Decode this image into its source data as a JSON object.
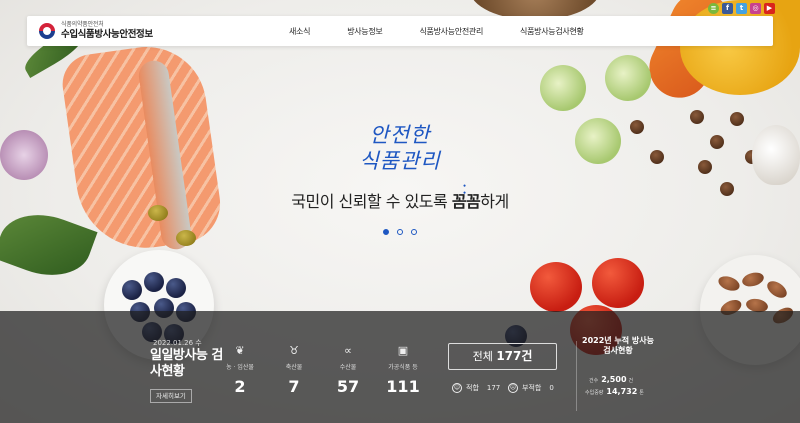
{
  "header": {
    "org_name": "식품의약품안전처",
    "site_name": "수입식품방사능안전정보",
    "nav": [
      "새소식",
      "방사능정보",
      "식품방사능안전관리",
      "식품방사능검사현황"
    ],
    "social_icons": [
      {
        "name": "naver-blog-icon",
        "color": "#7ab83b",
        "glyph": "≡"
      },
      {
        "name": "facebook-icon",
        "color": "#3b5998",
        "glyph": "f"
      },
      {
        "name": "twitter-icon",
        "color": "#45a2e0",
        "glyph": "t"
      },
      {
        "name": "instagram-icon",
        "color": "#c8418d",
        "glyph": "◎"
      },
      {
        "name": "youtube-icon",
        "color": "#d9251c",
        "glyph": "▶"
      }
    ]
  },
  "hero": {
    "title_line1": "안전한",
    "title_line2": "식품관리",
    "subtitle_prefix": "국민이 신뢰할 수 있도록 ",
    "subtitle_emphasis": "꼼꼼",
    "subtitle_suffix": "하게",
    "slides": 3,
    "active_slide": 1
  },
  "status": {
    "date": "2022.01.26 수",
    "title": "일일방사능 검사현황",
    "more_label": "자세히보기",
    "categories": [
      {
        "label": "농 · 임산물",
        "value": "2",
        "icon": "wheat-icon",
        "glyph": "❦"
      },
      {
        "label": "축산물",
        "value": "7",
        "icon": "livestock-icon",
        "glyph": "♉"
      },
      {
        "label": "수산물",
        "value": "57",
        "icon": "fish-icon",
        "glyph": "∝"
      },
      {
        "label": "가공식품 등",
        "value": "111",
        "icon": "processed-food-icon",
        "glyph": "▣"
      }
    ],
    "total_prefix": "전체 ",
    "total_value": "177건",
    "pass_label": "적합",
    "pass_value": "177",
    "fail_label": "부적합",
    "fail_value": "0",
    "annual": {
      "title": "2022년 누적 방사능 검사현황",
      "rows": [
        {
          "label": "건수",
          "value": "2,500",
          "unit": "건"
        },
        {
          "label": "수입중량",
          "value": "14,732",
          "unit": "톤"
        }
      ]
    }
  }
}
